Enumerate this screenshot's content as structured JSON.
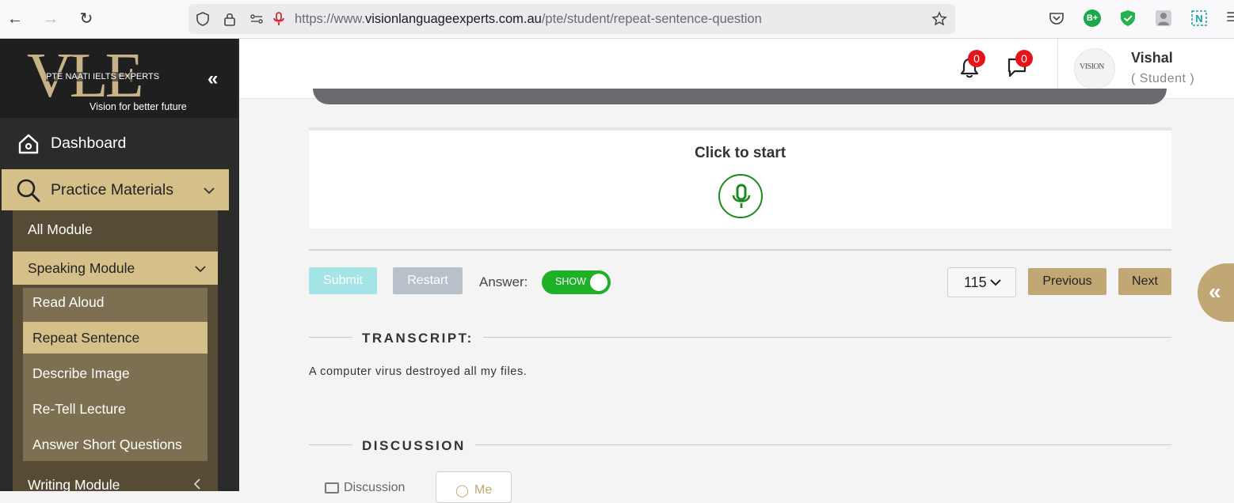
{
  "browser": {
    "url_prefix": "https://www.",
    "url_domain": "visionlanguageexperts.com.au",
    "url_path": "/pte/student/repeat-sentence-question",
    "back_icon": "←",
    "forward_icon": "→",
    "reload_icon": "↻",
    "extension_badge": "B+"
  },
  "sidebar": {
    "logo_text": "VLE",
    "logo_sub": "PTE NAATI IELTS EXPERTS",
    "logo_tagline": "Vision for better future",
    "collapse_icon": "«",
    "dashboard": "Dashboard",
    "practice": "Practice Materials",
    "menu": {
      "all_module": "All Module",
      "speaking_module": "Speaking Module",
      "writing_module": "Writing Module"
    },
    "speaking_items": [
      "Read Aloud",
      "Repeat Sentence",
      "Describe Image",
      "Re-Tell Lecture",
      "Answer Short Questions"
    ]
  },
  "header": {
    "notifications_count": "0",
    "messages_count": "0",
    "user_name": "Vishal",
    "user_role": "( Student )",
    "avatar_text": "VISION"
  },
  "main": {
    "click_to_start": "Click to start",
    "submit": "Submit",
    "restart": "Restart",
    "answer_label": "Answer:",
    "toggle_label": "SHOW",
    "question_number": "115",
    "previous": "Previous",
    "next": "Next",
    "transcript_title": "TRANSCRIPT:",
    "transcript_text": "A computer virus destroyed all my files.",
    "discussion_title": "DISCUSSION",
    "discussion_tab": "Discussion",
    "me_tab": "Me",
    "float_icon": "«"
  },
  "colors": {
    "gold": "#d6c08a",
    "gold_dark": "#c0a774",
    "sidebar_bg": "#2b2b2b",
    "green": "#1eb027",
    "badge_red": "#e5141b"
  }
}
